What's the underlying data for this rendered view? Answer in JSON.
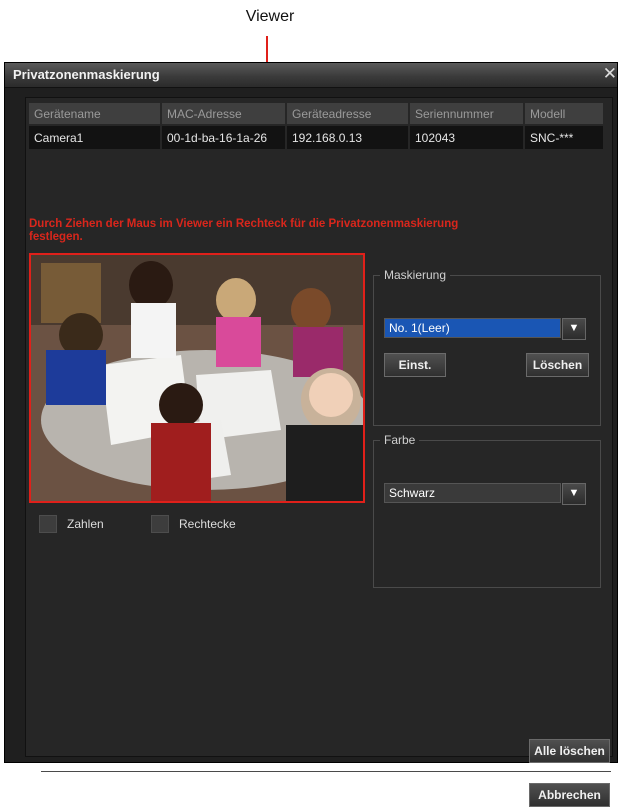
{
  "annotation": {
    "label": "Viewer"
  },
  "window": {
    "title": "Privatzonenmaskierung",
    "close_glyph": "✕"
  },
  "device_table": {
    "headers": [
      "Gerätename",
      "MAC-Adresse",
      "Geräteadresse",
      "Seriennummer",
      "Modell"
    ],
    "row": [
      "Camera1",
      "00-1d-ba-16-1a-26",
      "192.168.0.13",
      "102043",
      "SNC-***"
    ]
  },
  "instruction": "Durch Ziehen der Maus im Viewer ein Rechteck für die Privatzonenmaskierung festlegen.",
  "checkboxes": {
    "numbers": "Zahlen",
    "rectangles": "Rechtecke"
  },
  "masking": {
    "legend": "Maskierung",
    "selected": "No. 1(Leer)",
    "set_button": "Einst.",
    "delete_button": "Löschen"
  },
  "color": {
    "legend": "Farbe",
    "selected": "Schwarz"
  },
  "footer": {
    "delete_all_button": "Alle löschen",
    "cancel_button": "Abbrechen"
  },
  "colors": {
    "accent_red": "#e0201a",
    "selection_blue": "#1a56b4"
  }
}
